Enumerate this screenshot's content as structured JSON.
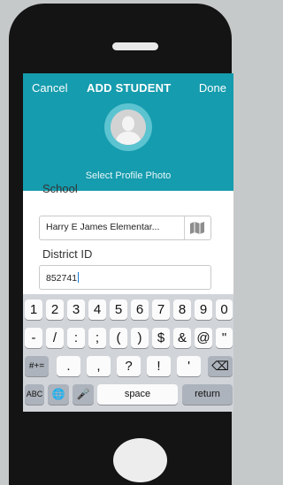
{
  "header": {
    "cancel_label": "Cancel",
    "title": "ADD STUDENT",
    "done_label": "Done"
  },
  "profile": {
    "select_photo_label": "Select Profile Photo"
  },
  "form": {
    "school_label": "School",
    "school_value": "Harry E James Elementar...",
    "district_label": "District ID",
    "district_value": "852741"
  },
  "keyboard": {
    "row1": [
      "1",
      "2",
      "3",
      "4",
      "5",
      "6",
      "7",
      "8",
      "9",
      "0"
    ],
    "row2": [
      "-",
      "/",
      ":",
      ";",
      "(",
      ")",
      "$",
      "&",
      "@",
      "\""
    ],
    "row3": [
      "#+=",
      ".",
      ",",
      "?",
      "!",
      "'",
      "⌫"
    ],
    "row4": {
      "abc": "ABC",
      "globe": "🌐",
      "mic": "🎤",
      "space": "space",
      "return": "return"
    }
  },
  "colors": {
    "accent": "#159cae",
    "background": "#c6c9c9"
  }
}
